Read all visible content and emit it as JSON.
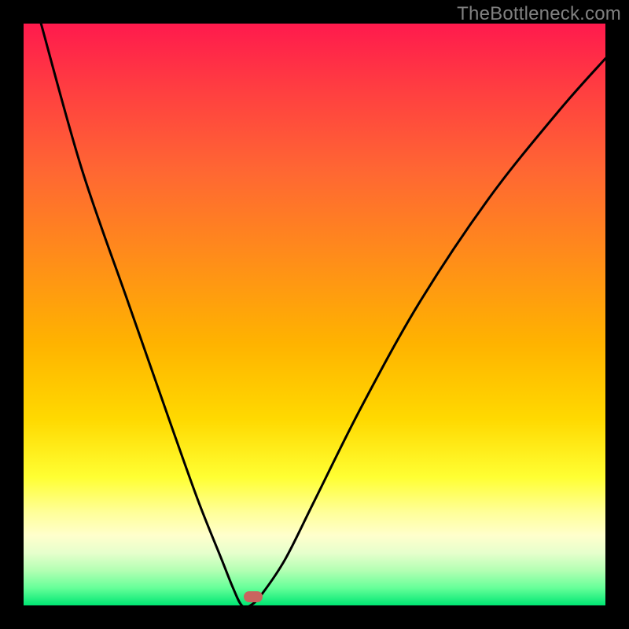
{
  "watermark": "TheBottleneck.com",
  "chart_data": {
    "type": "line",
    "title": "",
    "xlabel": "",
    "ylabel": "",
    "xlim": [
      0,
      100
    ],
    "ylim": [
      0,
      100
    ],
    "grid": false,
    "legend": false,
    "series": [
      {
        "name": "curve",
        "x": [
          3,
          10,
          18,
          25,
          30,
          34,
          36,
          37.5,
          39,
          41,
          45,
          50,
          58,
          68,
          80,
          92,
          100
        ],
        "y": [
          100,
          75,
          52,
          32,
          18,
          8,
          3,
          0,
          0,
          2,
          8,
          18,
          34,
          52,
          70,
          85,
          94
        ]
      }
    ],
    "marker": {
      "x": 39.5,
      "y": 1.5
    },
    "background_gradient": [
      {
        "stop": 0,
        "color": "#ff1a4d"
      },
      {
        "stop": 0.5,
        "color": "#ffcc00"
      },
      {
        "stop": 0.85,
        "color": "#ffff99"
      },
      {
        "stop": 1,
        "color": "#00e673"
      }
    ]
  }
}
